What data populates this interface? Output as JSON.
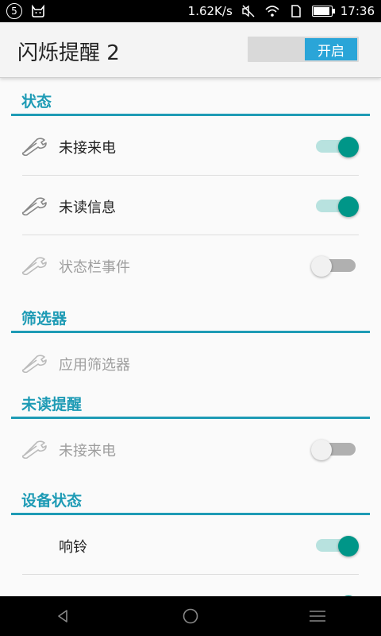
{
  "status_bar": {
    "notification_badge": "5",
    "speed": "1.62K/s",
    "time": "17:36",
    "icons": [
      "notification-count-icon",
      "cat-icon",
      "mute-icon",
      "wifi-icon",
      "sim-icon",
      "battery-icon"
    ]
  },
  "app_bar": {
    "title": "闪烁提醒 2",
    "master_switch_label": "开启"
  },
  "sections": [
    {
      "title": "状态",
      "rows": [
        {
          "label": "未接来电",
          "toggle": true,
          "enabled": true
        },
        {
          "label": "未读信息",
          "toggle": true,
          "enabled": true
        },
        {
          "label": "状态栏事件",
          "toggle": false,
          "enabled": false
        }
      ]
    },
    {
      "title": "筛选器",
      "rows": [
        {
          "label": "应用筛选器",
          "enabled": false
        }
      ]
    },
    {
      "title": "未读提醒",
      "rows": [
        {
          "label": "未接来电",
          "toggle": false,
          "enabled": false
        }
      ]
    },
    {
      "title": "设备状态",
      "rows": [
        {
          "label": "响铃",
          "toggle": true,
          "enabled": true
        }
      ]
    }
  ],
  "colors": {
    "accent": "#1e9bb5",
    "toggle_on": "#009688",
    "master_on": "#2aa5d8"
  }
}
